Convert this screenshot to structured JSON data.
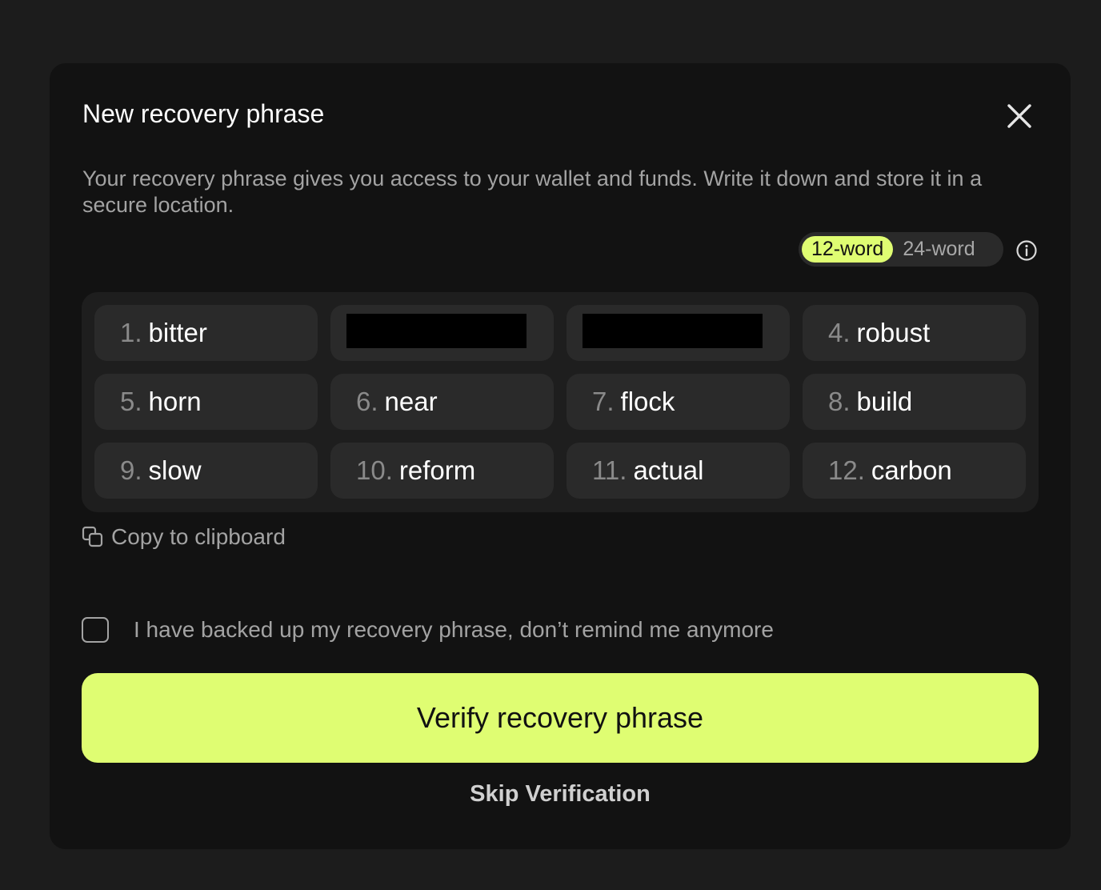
{
  "modal": {
    "title": "New recovery phrase",
    "description": "Your recovery phrase gives you access to your wallet and funds. Write it down and store it in a secure location.",
    "close_icon": "close-icon"
  },
  "toggle": {
    "options": [
      "12-word",
      "24-word"
    ],
    "selected": "12-word",
    "info_icon": "info-icon"
  },
  "words": [
    {
      "num": "1.",
      "word": "bitter",
      "redacted": false
    },
    {
      "num": "",
      "word": "",
      "redacted": true
    },
    {
      "num": "",
      "word": "",
      "redacted": true
    },
    {
      "num": "4.",
      "word": "robust",
      "redacted": false
    },
    {
      "num": "5.",
      "word": "horn",
      "redacted": false
    },
    {
      "num": "6.",
      "word": "near",
      "redacted": false
    },
    {
      "num": "7.",
      "word": "flock",
      "redacted": false
    },
    {
      "num": "8.",
      "word": "build",
      "redacted": false
    },
    {
      "num": "9.",
      "word": "slow",
      "redacted": false
    },
    {
      "num": "10.",
      "word": "reform",
      "redacted": false
    },
    {
      "num": "11.",
      "word": "actual",
      "redacted": false
    },
    {
      "num": "12.",
      "word": "carbon",
      "redacted": false
    }
  ],
  "copy": {
    "label": "Copy to clipboard",
    "icon": "copy-icon"
  },
  "backup": {
    "label": "I have backed up my recovery phrase, don’t remind me anymore",
    "checked": false
  },
  "actions": {
    "verify_label": "Verify recovery phrase",
    "skip_label": "Skip Verification"
  },
  "colors": {
    "accent": "#dffd72",
    "background": "#121212",
    "tile": "#2a2a2a"
  }
}
